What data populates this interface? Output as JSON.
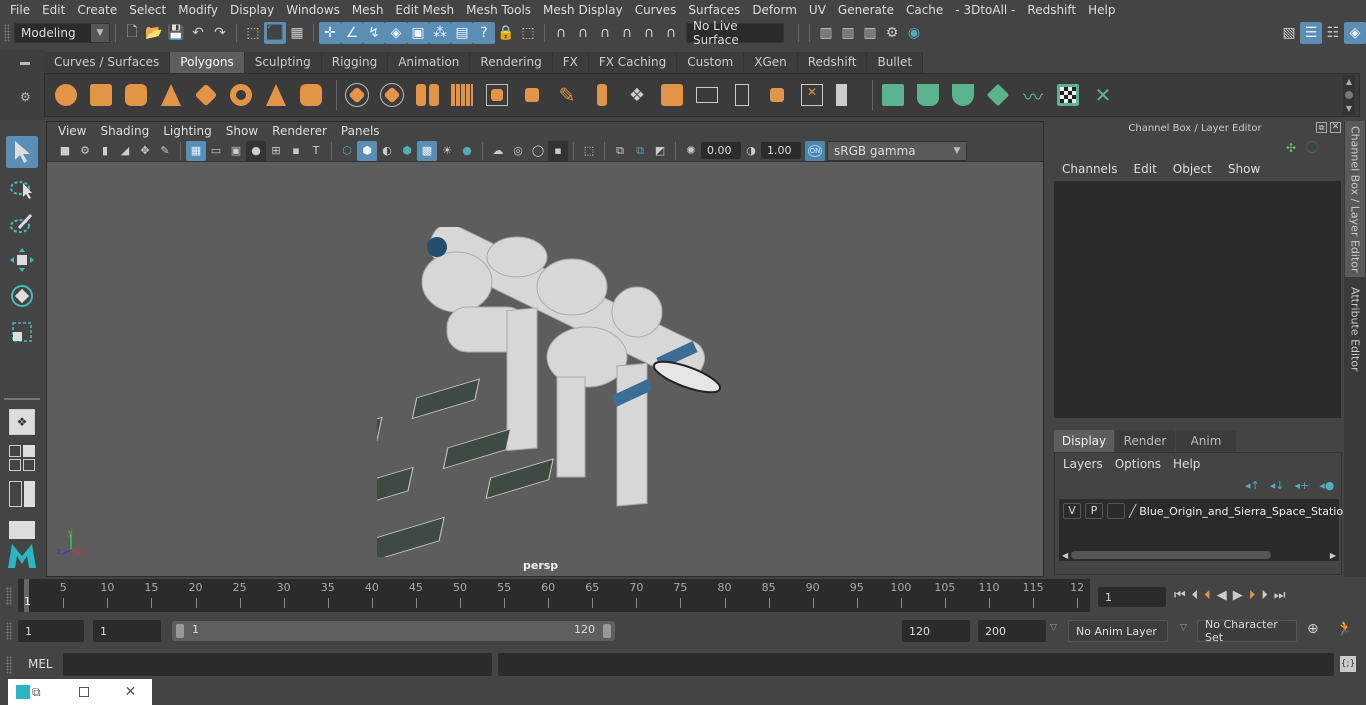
{
  "menubar": {
    "items": [
      "File",
      "Edit",
      "Create",
      "Select",
      "Modify",
      "Display",
      "Windows",
      "Mesh",
      "Edit Mesh",
      "Mesh Tools",
      "Mesh Display",
      "Curves",
      "Surfaces",
      "Deform",
      "UV",
      "Generate",
      "Cache",
      "- 3DtoAll -",
      "Redshift",
      "Help"
    ]
  },
  "statusline": {
    "mode": "Modeling",
    "live_surface": "No Live Surface"
  },
  "shelf": {
    "tabs": [
      "Curves / Surfaces",
      "Polygons",
      "Sculpting",
      "Rigging",
      "Animation",
      "Rendering",
      "FX",
      "FX Caching",
      "Custom",
      "XGen",
      "Redshift",
      "Bullet"
    ],
    "active_tab": "Polygons"
  },
  "viewport": {
    "menu": [
      "View",
      "Shading",
      "Lighting",
      "Show",
      "Renderer",
      "Panels"
    ],
    "exposure": "0.00",
    "gamma": "1.00",
    "color_space": "sRGB gamma",
    "color_mgmt_toggle": "ON",
    "camera_label": "persp",
    "axis": {
      "x": "x",
      "y": "y",
      "z": "z"
    }
  },
  "channel_box": {
    "title": "Channel Box / Layer Editor",
    "menu": [
      "Channels",
      "Edit",
      "Object",
      "Show"
    ]
  },
  "layer_editor": {
    "tabs": [
      "Display",
      "Render",
      "Anim"
    ],
    "active_tab": "Display",
    "menu": [
      "Layers",
      "Options",
      "Help"
    ],
    "layers": [
      {
        "v": "V",
        "p": "P",
        "name": "Blue_Origin_and_Sierra_Space_Statio"
      }
    ]
  },
  "side_tabs": [
    "Channel Box / Layer Editor",
    "Attribute Editor"
  ],
  "timeline": {
    "ticks": [
      5,
      10,
      15,
      20,
      25,
      30,
      35,
      40,
      45,
      50,
      55,
      60,
      65,
      70,
      75,
      80,
      85,
      90,
      95,
      100,
      105,
      110,
      115,
      "12"
    ],
    "current_frame_marker": "1",
    "current_frame": "1"
  },
  "range": {
    "start_time": "1",
    "playback_start": "1",
    "slider_start": "1",
    "slider_end": "120",
    "playback_end": "120",
    "end_time": "200",
    "anim_layer": "No Anim Layer",
    "character_set": "No Character Set"
  },
  "command_line": {
    "label": "MEL",
    "input": "",
    "output": ""
  }
}
